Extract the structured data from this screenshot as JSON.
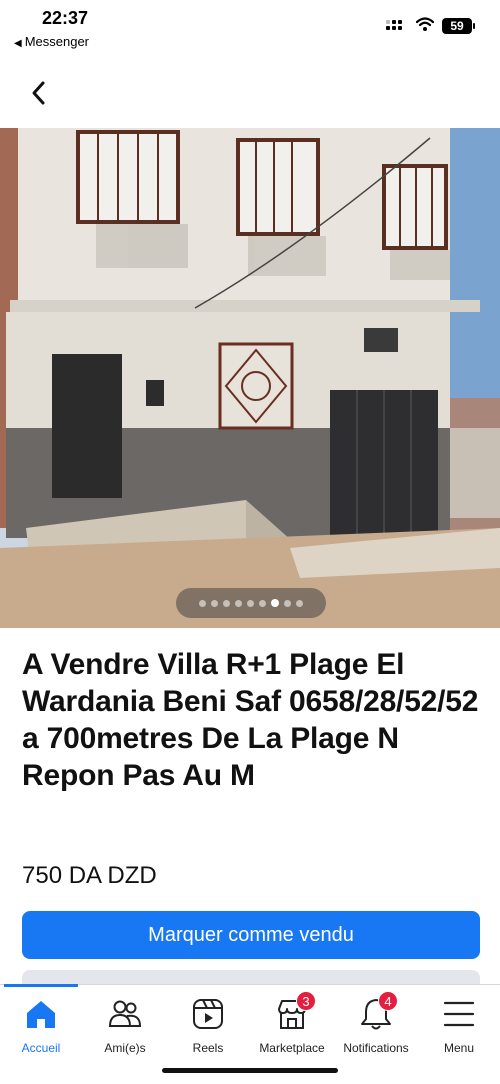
{
  "status_bar": {
    "time": "22:37",
    "back_app": "Messenger",
    "battery": "59"
  },
  "nav": {
    "back_icon": "chevron-left-icon"
  },
  "carousel": {
    "total": 9,
    "active_index": 6
  },
  "listing": {
    "title": "A Vendre Villa R+1 Plage El Wardania Beni Saf 0658/28/52/52 a 700metres De La Plage N Repon Pas Au M",
    "price": "750 DA DZD"
  },
  "actions": {
    "mark_sold": "Marquer comme vendu"
  },
  "tabs": [
    {
      "label": "Accueil",
      "icon": "home-icon",
      "active": true
    },
    {
      "label": "Ami(e)s",
      "icon": "friends-icon"
    },
    {
      "label": "Reels",
      "icon": "reels-icon"
    },
    {
      "label": "Marketplace",
      "icon": "marketplace-icon",
      "badge": "3"
    },
    {
      "label": "Notifications",
      "icon": "bell-icon",
      "badge": "4"
    },
    {
      "label": "Menu",
      "icon": "menu-icon"
    }
  ],
  "colors": {
    "accent": "#1877f2",
    "badge": "#e41e3f"
  }
}
